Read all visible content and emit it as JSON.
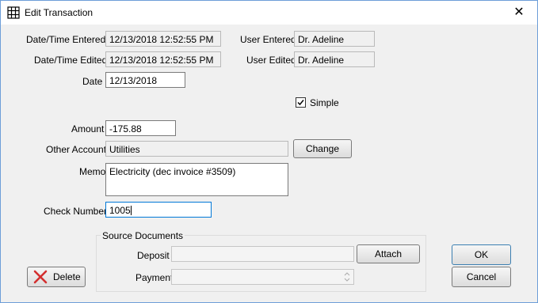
{
  "window": {
    "title": "Edit Transaction"
  },
  "form": {
    "entered_label": "Date/Time  Entered",
    "entered_value": "12/13/2018 12:52:55 PM",
    "user_entered_label": "User Entered",
    "user_entered_value": "Dr. Adeline",
    "edited_label": "Date/Time Edited",
    "edited_value": "12/13/2018 12:52:55 PM",
    "user_edited_label": "User Edited",
    "user_edited_value": "Dr. Adeline",
    "date_label": "Date",
    "date_value": "12/13/2018",
    "simple_label": "Simple",
    "simple_checked": true,
    "amount_label": "Amount",
    "amount_value": "-175.88",
    "other_account_label": "Other Account",
    "other_account_value": "Utilities",
    "change_label": "Change",
    "memo_label": "Memo",
    "memo_value": "Electricity (dec invoice #3509)",
    "check_number_label": "Check Number",
    "check_number_value": "1005"
  },
  "source_documents": {
    "title": "Source Documents",
    "deposit_label": "Deposit",
    "deposit_value": "",
    "attach_label": "Attach",
    "payment_label": "Payment",
    "payment_value": ""
  },
  "buttons": {
    "ok": "OK",
    "cancel": "Cancel",
    "delete": "Delete"
  },
  "icons": {
    "title": "grid-icon",
    "close": "close-icon",
    "delete": "red-x-icon",
    "check": "checkmark-icon",
    "spin": "spin-arrows-icon"
  },
  "colors": {
    "focus_border": "#0078d7",
    "delete_icon": "#d32f2f",
    "window_border": "#6d9ed8"
  }
}
